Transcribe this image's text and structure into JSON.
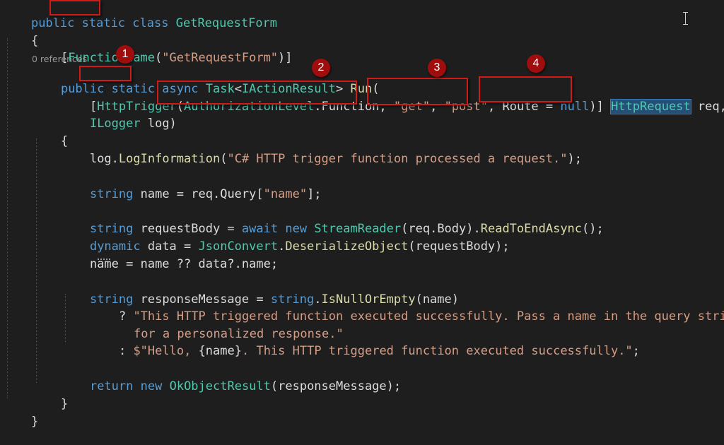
{
  "code": {
    "l1": {
      "t1": "public",
      "t2": " ",
      "t3": "static",
      "t4": " ",
      "t5": "class",
      "t6": " ",
      "t7": "GetRequestForm"
    },
    "l2": {
      "t1": "{"
    },
    "l3": {
      "t1": "[",
      "t2": "FunctionName",
      "t3": "(",
      "t4": "\"GetRequestForm\"",
      "t5": ")]"
    },
    "lens": "0 references",
    "l4": {
      "t1": "public",
      "t2": " ",
      "t3": "static",
      "t4": " ",
      "t5": "async",
      "t6": " ",
      "t7": "Task",
      "t8": "<",
      "t9": "IActionResult",
      "t10": "> ",
      "t11": "Run",
      "t12": "("
    },
    "l5": {
      "t1": "[",
      "t2": "HttpTrigger",
      "t3": "(",
      "t4": "AuthorizationLevel",
      "t5": ".",
      "t6": "Function",
      "t7": ", ",
      "t8": "\"get\"",
      "t9": ", ",
      "t10": "\"post\"",
      "t11": ", ",
      "t12": "Route",
      "t13": " = ",
      "t14": "null",
      "t15": ")] ",
      "t16": "HttpRequest",
      "t17": " req,"
    },
    "l6": {
      "t1": "ILogger",
      "t2": " log)"
    },
    "l7": {
      "t1": "{"
    },
    "l8": {
      "t1": "log",
      "t2": ".",
      "t3": "LogInformation",
      "t4": "(",
      "t5": "\"C# HTTP trigger function processed a request.\"",
      "t6": ");"
    },
    "l9": {
      "t1": "string",
      "t2": " name = req.",
      "t3": "Query",
      "t4": "[",
      "t5": "\"name\"",
      "t6": "];"
    },
    "l10": {
      "t1": "string",
      "t2": " requestBody = ",
      "t3": "await",
      "t4": " ",
      "t5": "new",
      "t6": " ",
      "t7": "StreamReader",
      "t8": "(req.Body).",
      "t9": "ReadToEndAsync",
      "t10": "();"
    },
    "l11": {
      "t1": "dynamic",
      "t2": " data = ",
      "t3": "JsonConvert",
      "t4": ".",
      "t5": "DeserializeObject",
      "t6": "(requestBody);"
    },
    "l12": {
      "t1": "name = name ?? data?.name;"
    },
    "l13": {
      "t1": "string",
      "t2": " responseMessage = ",
      "t3": "string",
      "t4": ".",
      "t5": "IsNullOrEmpty",
      "t6": "(name)"
    },
    "l14": {
      "t1": "? ",
      "t2": "\"This HTTP triggered function executed successfully. Pass a name in the query string"
    },
    "l15": {
      "t1": "for a personalized response.\""
    },
    "l16": {
      "t1": ": ",
      "t2": "$\"Hello, ",
      "t3": "{name}",
      "t4": ". This HTTP triggered function executed successfully.\"",
      "t5": ";"
    },
    "l17": {
      "t1": "return",
      "t2": " ",
      "t3": "new",
      "t4": " ",
      "t5": "OkObjectResult",
      "t6": "(responseMessage);"
    },
    "l18": {
      "t1": "}"
    },
    "l19": {
      "t1": "}"
    }
  },
  "annotations": {
    "badge1": "1",
    "badge2": "2",
    "badge3": "3",
    "badge4": "4"
  },
  "colors": {
    "background": "#1e1e1e",
    "keyword": "#569cd6",
    "type": "#4ec9b0",
    "method": "#dcdcaa",
    "string": "#d69d85",
    "text": "#dcdcdc",
    "annotation_red": "#d11a1a",
    "badge_fill": "#a00d0d"
  }
}
